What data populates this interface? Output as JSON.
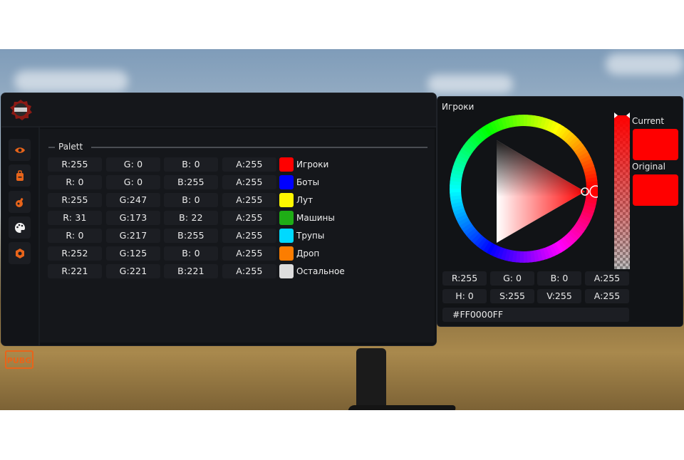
{
  "main_panel": {
    "section_title": "Palett",
    "sidebar_icons": [
      "eye-icon",
      "backpack-icon",
      "grenade-icon",
      "palette-icon",
      "gear-icon"
    ],
    "brand_logo_text": "PUBG",
    "colors": {
      "accent": "#e8641a",
      "panel_bg": "#15171b",
      "cell_bg": "#1c1e23"
    },
    "rows": [
      {
        "r": "R:255",
        "g": "G: 0",
        "b": "B: 0",
        "a": "A:255",
        "label": "Игроки",
        "swatch": "#ff0000"
      },
      {
        "r": "R: 0",
        "g": "G: 0",
        "b": "B:255",
        "a": "A:255",
        "label": "Боты",
        "swatch": "#0000ff"
      },
      {
        "r": "R:255",
        "g": "G:247",
        "b": "B: 0",
        "a": "A:255",
        "label": "Лут",
        "swatch": "#fff700"
      },
      {
        "r": "R: 31",
        "g": "G:173",
        "b": "B: 22",
        "a": "A:255",
        "label": "Машины",
        "swatch": "#1fad16"
      },
      {
        "r": "R: 0",
        "g": "G:217",
        "b": "B:255",
        "a": "A:255",
        "label": "Трупы",
        "swatch": "#00d9ff"
      },
      {
        "r": "R:252",
        "g": "G:125",
        "b": "B: 0",
        "a": "A:255",
        "label": "Дроп",
        "swatch": "#fc7d00"
      },
      {
        "r": "R:221",
        "g": "G:221",
        "b": "B:221",
        "a": "A:255",
        "label": "Остальное",
        "swatch": "#dddddd"
      }
    ]
  },
  "picker": {
    "title": "Игроки",
    "current_label": "Current",
    "original_label": "Original",
    "current_color": "#ff0000",
    "original_color": "#ff0000",
    "rgba": {
      "r": "R:255",
      "g": "G: 0",
      "b": "B: 0",
      "a": "A:255"
    },
    "hsva": {
      "h": "H: 0",
      "s": "S:255",
      "v": "V:255",
      "a": "A:255"
    },
    "hex": "#FF0000FF"
  }
}
